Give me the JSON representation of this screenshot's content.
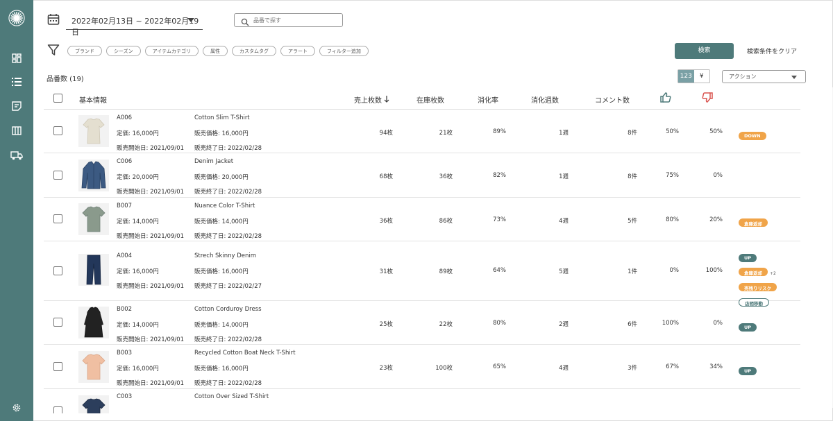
{
  "colors": {
    "brand": "#4e7a7a",
    "badge_orange": "#f0a449",
    "thumb_down": "#d9534f"
  },
  "header": {
    "date_range": "2022年02月13日 ~ 2022年02月19日",
    "search_placeholder": "品番で探す"
  },
  "filters": [
    "ブランド",
    "シーズン",
    "アイテムカテゴリ",
    "属性",
    "カスタムタグ",
    "アラート",
    "フィルター追加"
  ],
  "search_button": "検索",
  "clear_button": "検索条件をクリア",
  "count_label": "品番数 (19)",
  "toggle": {
    "count": "123",
    "yen": "¥"
  },
  "action_select": "アクション",
  "columns": {
    "basic": "基本情報",
    "sales": "売上枚数",
    "stock": "在庫枚数",
    "sell_through": "消化率",
    "weeks": "消化週数",
    "comments": "コメント数"
  },
  "sidebar_icons": [
    "dashboard-icon",
    "list-icon",
    "note-icon",
    "book-icon",
    "truck-icon",
    "settings-icon"
  ],
  "rows": [
    {
      "code": "A006",
      "list_price": "定価: 16,000円",
      "start": "販売開始日: 2021/09/01",
      "name": "Cotton Slim T-Shirt",
      "sale_price": "販売価格: 16,000円",
      "end": "販売終了日: 2022/02/28",
      "sales": "94枚",
      "stock": "21枚",
      "rate": "89%",
      "weeks": "1週",
      "comments": "8件",
      "up": "50%",
      "down": "50%",
      "badges": [
        {
          "text": "DOWN",
          "style": "orange"
        }
      ],
      "thumb": "tshirt-beige"
    },
    {
      "code": "C006",
      "list_price": "定価: 20,000円",
      "start": "販売開始日: 2021/09/01",
      "name": "Denim Jacket",
      "sale_price": "販売価格: 20,000円",
      "end": "販売終了日: 2022/02/28",
      "sales": "68枚",
      "stock": "36枚",
      "rate": "82%",
      "weeks": "1週",
      "comments": "8件",
      "up": "75%",
      "down": "0%",
      "badges": [],
      "thumb": "jacket-denim"
    },
    {
      "code": "B007",
      "list_price": "定価: 14,000円",
      "start": "販売開始日: 2021/09/01",
      "name": "Nuance Color T-Shirt",
      "sale_price": "販売価格: 14,000円",
      "end": "販売終了日: 2022/02/28",
      "sales": "36枚",
      "stock": "86枚",
      "rate": "73%",
      "weeks": "4週",
      "comments": "5件",
      "up": "80%",
      "down": "20%",
      "badges": [
        {
          "text": "倉庫返却",
          "style": "orange"
        }
      ],
      "thumb": "tshirt-gray"
    },
    {
      "code": "A004",
      "list_price": "定価: 16,000円",
      "start": "販売開始日: 2021/09/01",
      "name": "Strech Skinny Denim",
      "sale_price": "販売価格: 16,000円",
      "end": "販売終了日: 2022/02/27",
      "sales": "31枚",
      "stock": "89枚",
      "rate": "64%",
      "weeks": "5週",
      "comments": "1件",
      "up": "0%",
      "down": "100%",
      "badges": [
        {
          "text": "UP",
          "style": "teal"
        },
        {
          "text": "倉庫返却",
          "style": "orange",
          "extra": "+2"
        },
        {
          "text": "売残りリスク",
          "style": "orange"
        },
        {
          "text": "店間移動",
          "style": "outline"
        }
      ],
      "thumb": "jeans"
    },
    {
      "code": "B002",
      "list_price": "定価: 14,000円",
      "start": "販売開始日: 2021/09/01",
      "name": "Cotton Corduroy Dress",
      "sale_price": "販売価格: 14,000円",
      "end": "販売終了日: 2022/02/28",
      "sales": "25枚",
      "stock": "22枚",
      "rate": "80%",
      "weeks": "2週",
      "comments": "6件",
      "up": "100%",
      "down": "0%",
      "badges": [
        {
          "text": "UP",
          "style": "teal"
        }
      ],
      "thumb": "dress-black"
    },
    {
      "code": "B003",
      "list_price": "定価: 16,000円",
      "start": "販売開始日: 2021/09/01",
      "name": "Recycled Cotton Boat Neck T-Shirt",
      "sale_price": "販売価格: 16,000円",
      "end": "販売終了日: 2022/02/28",
      "sales": "23枚",
      "stock": "100枚",
      "rate": "65%",
      "weeks": "4週",
      "comments": "3件",
      "up": "67%",
      "down": "34%",
      "badges": [
        {
          "text": "UP",
          "style": "teal"
        }
      ],
      "thumb": "tshirt-peach"
    },
    {
      "code": "C003",
      "list_price": "",
      "start": "",
      "name": "Cotton Over Sized T-Shirt",
      "sale_price": "",
      "end": "",
      "sales": "",
      "stock": "",
      "rate": "",
      "weeks": "",
      "comments": "",
      "up": "",
      "down": "",
      "badges": [],
      "thumb": "tshirt-navy"
    }
  ]
}
